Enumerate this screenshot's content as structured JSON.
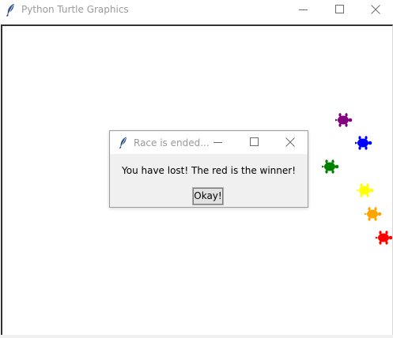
{
  "window": {
    "title": "Python Turtle Graphics"
  },
  "turtles": [
    {
      "name": "purple",
      "color": "#800080"
    },
    {
      "name": "blue",
      "color": "#0000ff"
    },
    {
      "name": "green",
      "color": "#008000"
    },
    {
      "name": "yellow",
      "color": "#ffff00"
    },
    {
      "name": "orange",
      "color": "#ffa500"
    },
    {
      "name": "red",
      "color": "#ff0000"
    }
  ],
  "dialog": {
    "title": "Race is ended...",
    "message": "You have lost! The red is the winner!",
    "ok_label": "Okay!"
  },
  "icons": {
    "app": "feather-icon",
    "minimize": "minimize-icon",
    "maximize": "maximize-icon",
    "close": "close-icon"
  }
}
